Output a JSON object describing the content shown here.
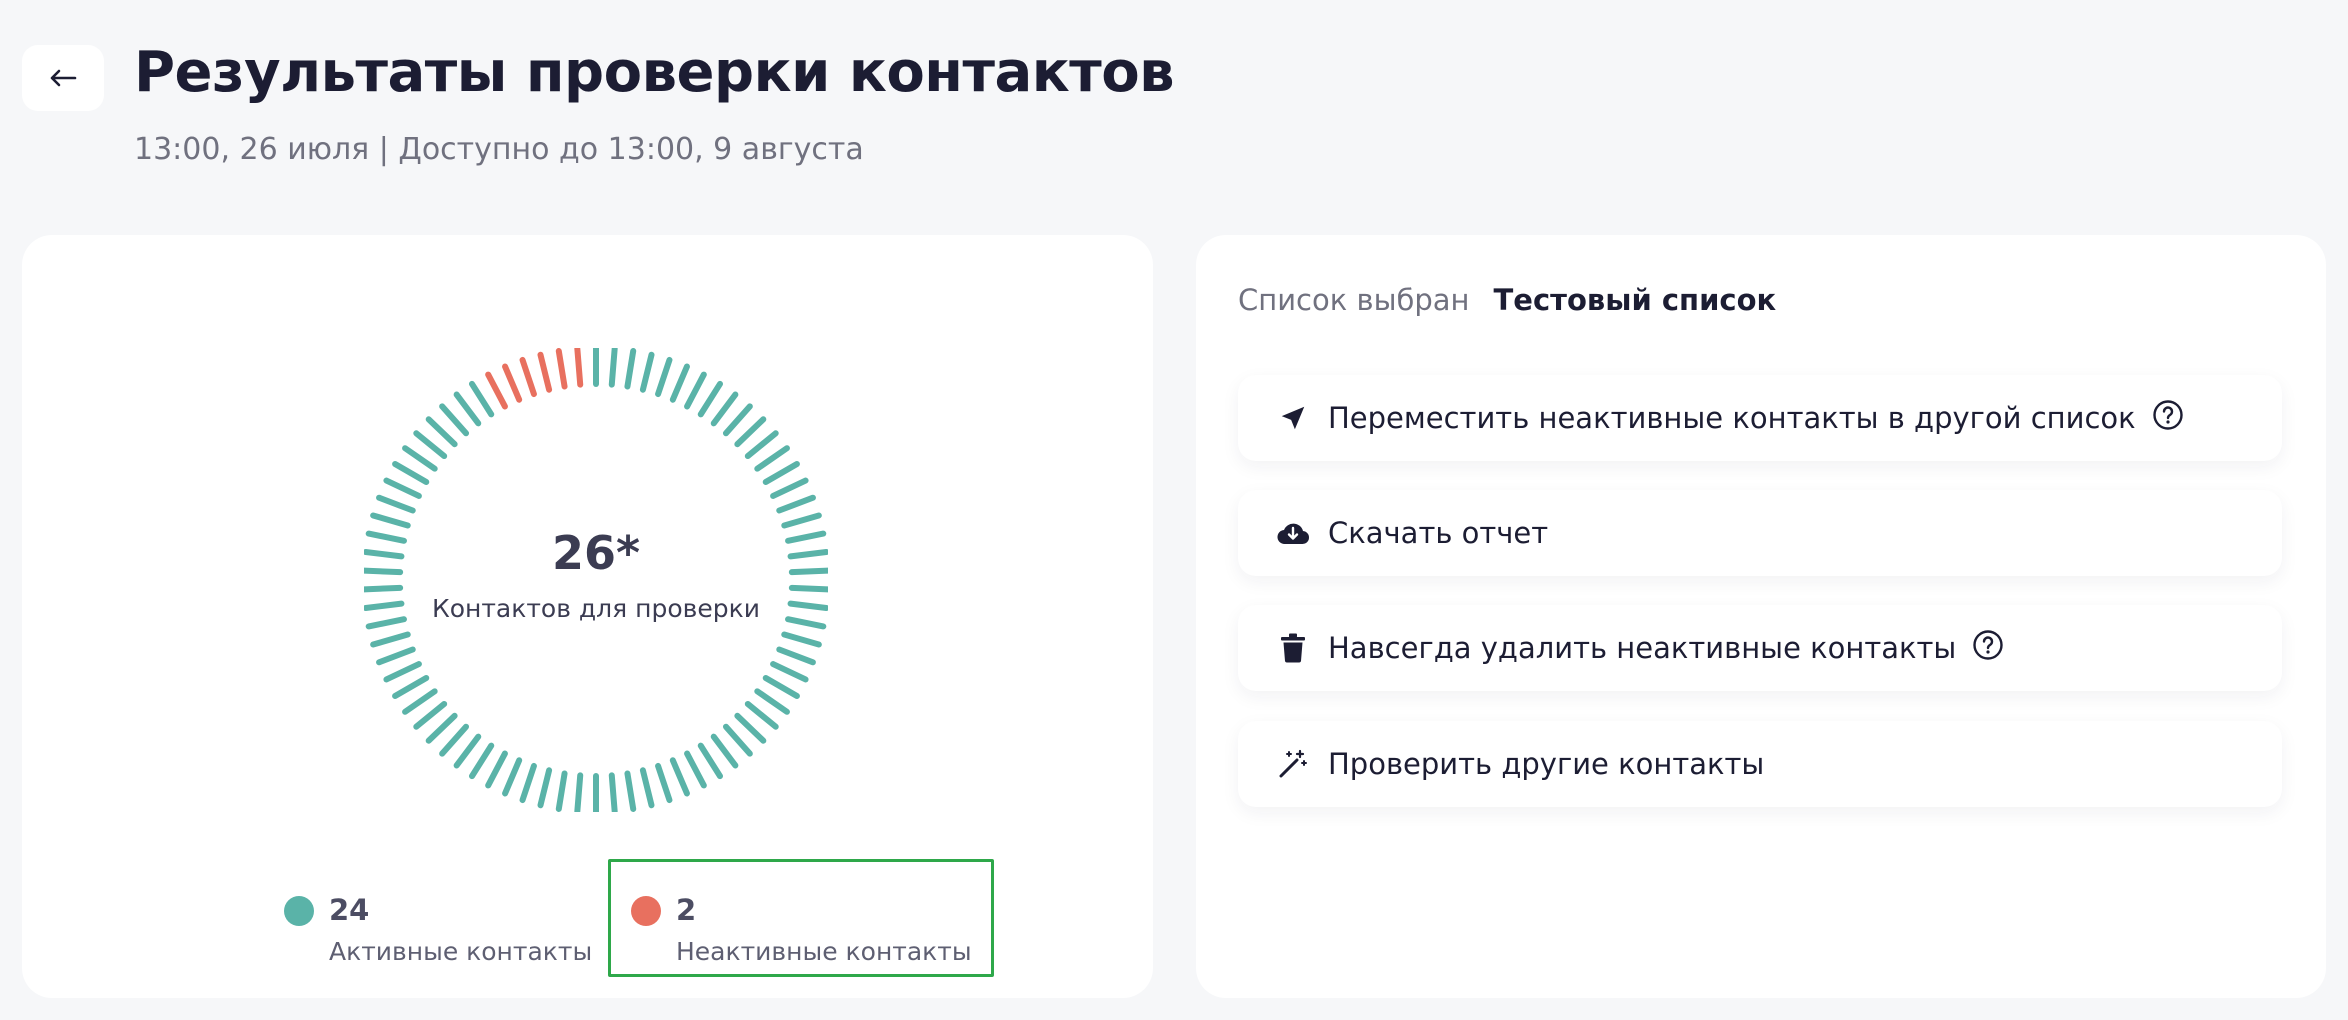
{
  "header": {
    "title": "Результаты проверки контактов",
    "subtitle": "13:00, 26 июля | Доступно до 13:00, 9 августа",
    "back_icon": "arrow-left-icon"
  },
  "summary": {
    "total": "26*",
    "total_label": "Контактов для проверки",
    "colors": {
      "active": "#5ab3a8",
      "inactive": "#e8705f"
    },
    "legend": [
      {
        "value": "24",
        "label": "Активные контакты",
        "color": "#5ab3a8"
      },
      {
        "value": "2",
        "label": "Неактивные контакты",
        "color": "#e8705f"
      }
    ]
  },
  "list": {
    "label": "Список выбран",
    "value": "Тестовый список"
  },
  "actions": [
    {
      "label": "Переместить неактивные контакты в другой список",
      "icon": "send-icon",
      "help": true
    },
    {
      "label": "Скачать отчет",
      "icon": "cloud-download-icon",
      "help": false
    },
    {
      "label": "Навсегда удалить неактивные контакты",
      "icon": "trash-icon",
      "help": true
    },
    {
      "label": "Проверить другие контакты",
      "icon": "magic-wand-icon",
      "help": false
    }
  ]
}
